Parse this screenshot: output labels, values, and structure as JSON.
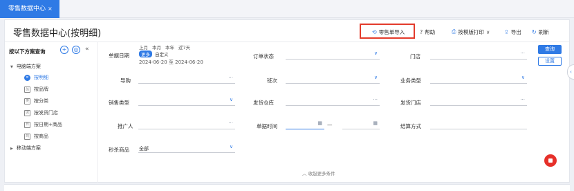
{
  "tabbar": {
    "tab_label": "零售数据中心",
    "close_glyph": "×"
  },
  "header": {
    "title": "零售数据中心(按明细)"
  },
  "toolbar": {
    "import": {
      "label": "零售单导入",
      "icon": "import-icon"
    },
    "help": {
      "label": "帮助",
      "icon": "help-icon"
    },
    "print": {
      "label": "按模版打印",
      "icon": "print-icon"
    },
    "export": {
      "label": "导出",
      "icon": "export-icon"
    },
    "refresh": {
      "label": "刷新",
      "icon": "refresh-icon"
    }
  },
  "sidebar": {
    "heading": "按以下方案查询",
    "add_glyph": "+",
    "settings_glyph": "◎",
    "collapse_glyph": "«",
    "groups": [
      {
        "label": "电脑端方案",
        "expanded": true
      },
      {
        "label": "移动端方案",
        "expanded": false
      }
    ],
    "items": [
      {
        "label": "按明细",
        "active": true,
        "glyph": "≡"
      },
      {
        "label": "按品牌",
        "active": false,
        "glyph": "品"
      },
      {
        "label": "按分类",
        "active": false,
        "glyph": "类"
      },
      {
        "label": "按发货门店",
        "active": false,
        "glyph": "店"
      },
      {
        "label": "按日期+商品",
        "active": false,
        "glyph": "日"
      },
      {
        "label": "按商品",
        "active": false,
        "glyph": "商"
      }
    ]
  },
  "filters": {
    "date_label": "单据日期",
    "date_options": [
      "上月",
      "本月",
      "本年",
      "近7天"
    ],
    "date_chip": "更多",
    "date_custom": "自定义",
    "date_range": "2024-06-20 至 2024-06-20",
    "order_status": "订单状态",
    "store": "门店",
    "guide": "导购",
    "batch": "班次",
    "business_type": "业务类型",
    "sales_type": "销售类型",
    "ship_warehouse": "发货仓库",
    "ship_store": "发货门店",
    "promoter": "推广人",
    "doc_time": "单据时间",
    "time_sep": "—",
    "settlement": "结算方式",
    "flash_sale": "秒杀商品",
    "flash_sale_value": "全部",
    "dots": "···",
    "chevron": "∨",
    "calendar_glyph": "▦"
  },
  "buttons": {
    "query": "查询",
    "settings": "设置"
  },
  "collapse_more": {
    "icon": "chevron-up-icon",
    "glyph": "︿",
    "label": "收起更多条件"
  },
  "side_handle_glyph": "‹",
  "colors": {
    "accent": "#2f7ae5",
    "highlight": "#e33b2b",
    "fab": "#e6302a"
  }
}
